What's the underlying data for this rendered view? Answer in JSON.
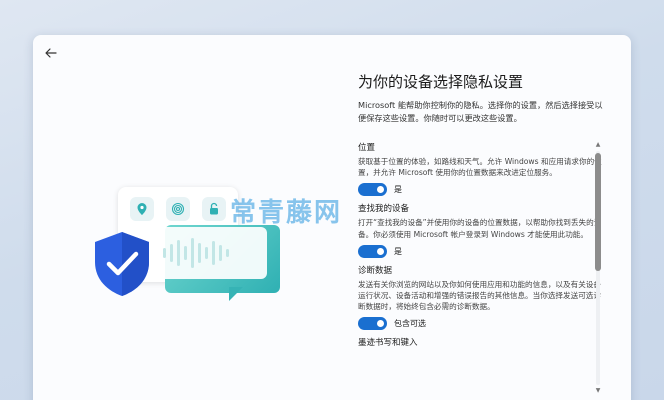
{
  "page": {
    "title": "为你的设备选择隐私设置",
    "intro": "Microsoft 能帮助你控制你的隐私。选择你的设置，然后选择接受以便保存这些设置。你随时可以更改这些设置。"
  },
  "sections": [
    {
      "title": "位置",
      "desc": "获取基于位置的体验，如路线和天气。允许 Windows 和应用请求你的位置，并允许 Microsoft 使用你的位置数据来改进定位服务。",
      "toggle_label": "是"
    },
    {
      "title": "查找我的设备",
      "desc": "打开“查找我的设备”并使用你的设备的位置数据，以帮助你找到丢失的设备。你必须使用 Microsoft 帐户登录到 Windows 才能使用此功能。",
      "toggle_label": "是"
    },
    {
      "title": "诊断数据",
      "desc": "发送有关你浏览的网站以及你如何使用应用和功能的信息，以及有关设备运行状况、设备活动和增强的错误报告的其他信息。当你选择发送可选诊断数据时，将始终包含必需的诊断数据。",
      "toggle_label": "包含可选"
    },
    {
      "title": "墨迹书写和键入",
      "desc": "",
      "toggle_label": ""
    }
  ],
  "watermark": "常青藤网",
  "colors": {
    "accent": "#1a6fd0",
    "illustration_teal": "#2fb0b3",
    "shield_blue": "#2c5fe0"
  },
  "icons": [
    "back-arrow-icon",
    "location-pin-icon",
    "fingerprint-icon",
    "lock-icon",
    "shield-check-icon"
  ]
}
